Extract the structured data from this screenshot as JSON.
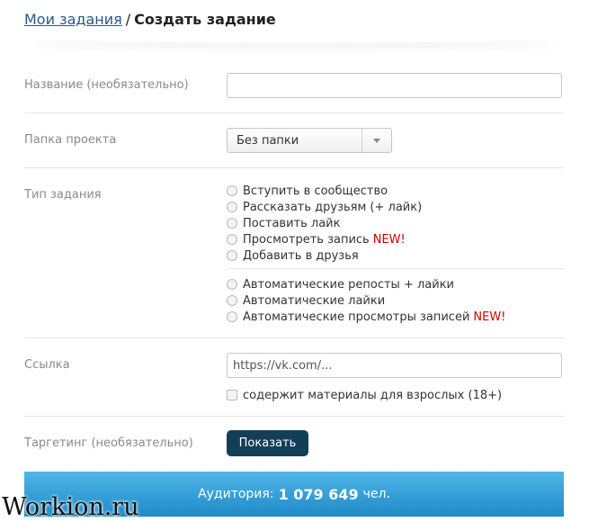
{
  "breadcrumb": {
    "parent": "Мои задания",
    "separator": "/",
    "current": "Создать задание"
  },
  "form": {
    "name_label": "Название (необязательно)",
    "name_value": "",
    "folder_label": "Папка проекта",
    "folder_value": "Без папки",
    "type_label": "Тип задания",
    "task_types": [
      {
        "label": "Вступить в сообщество",
        "new": ""
      },
      {
        "label": "Рассказать друзьям (+ лайк)",
        "new": ""
      },
      {
        "label": "Поставить лайк",
        "new": ""
      },
      {
        "label": "Просмотреть запись",
        "new": "NEW!"
      },
      {
        "label": "Добавить в друзья",
        "new": ""
      }
    ],
    "auto_types": [
      {
        "label": "Автоматические репосты + лайки",
        "new": ""
      },
      {
        "label": "Автоматические лайки",
        "new": ""
      },
      {
        "label": "Автоматические просмотры записей",
        "new": "NEW!"
      }
    ],
    "link_label": "Ссылка",
    "link_placeholder": "https://vk.com/...",
    "adult_label": "содержит материалы для взрослых (18+)",
    "targeting_label": "Таргетинг (необязательно)",
    "show_button": "Показать"
  },
  "audience": {
    "prefix": "Аудитория:",
    "count": "1 079 649",
    "unit": "чел."
  },
  "watermark": "Workion.ru",
  "colors": {
    "link": "#2a5885",
    "button": "#133e58",
    "new_badge": "#d20000",
    "audience_bar": "#2a9ad6"
  }
}
